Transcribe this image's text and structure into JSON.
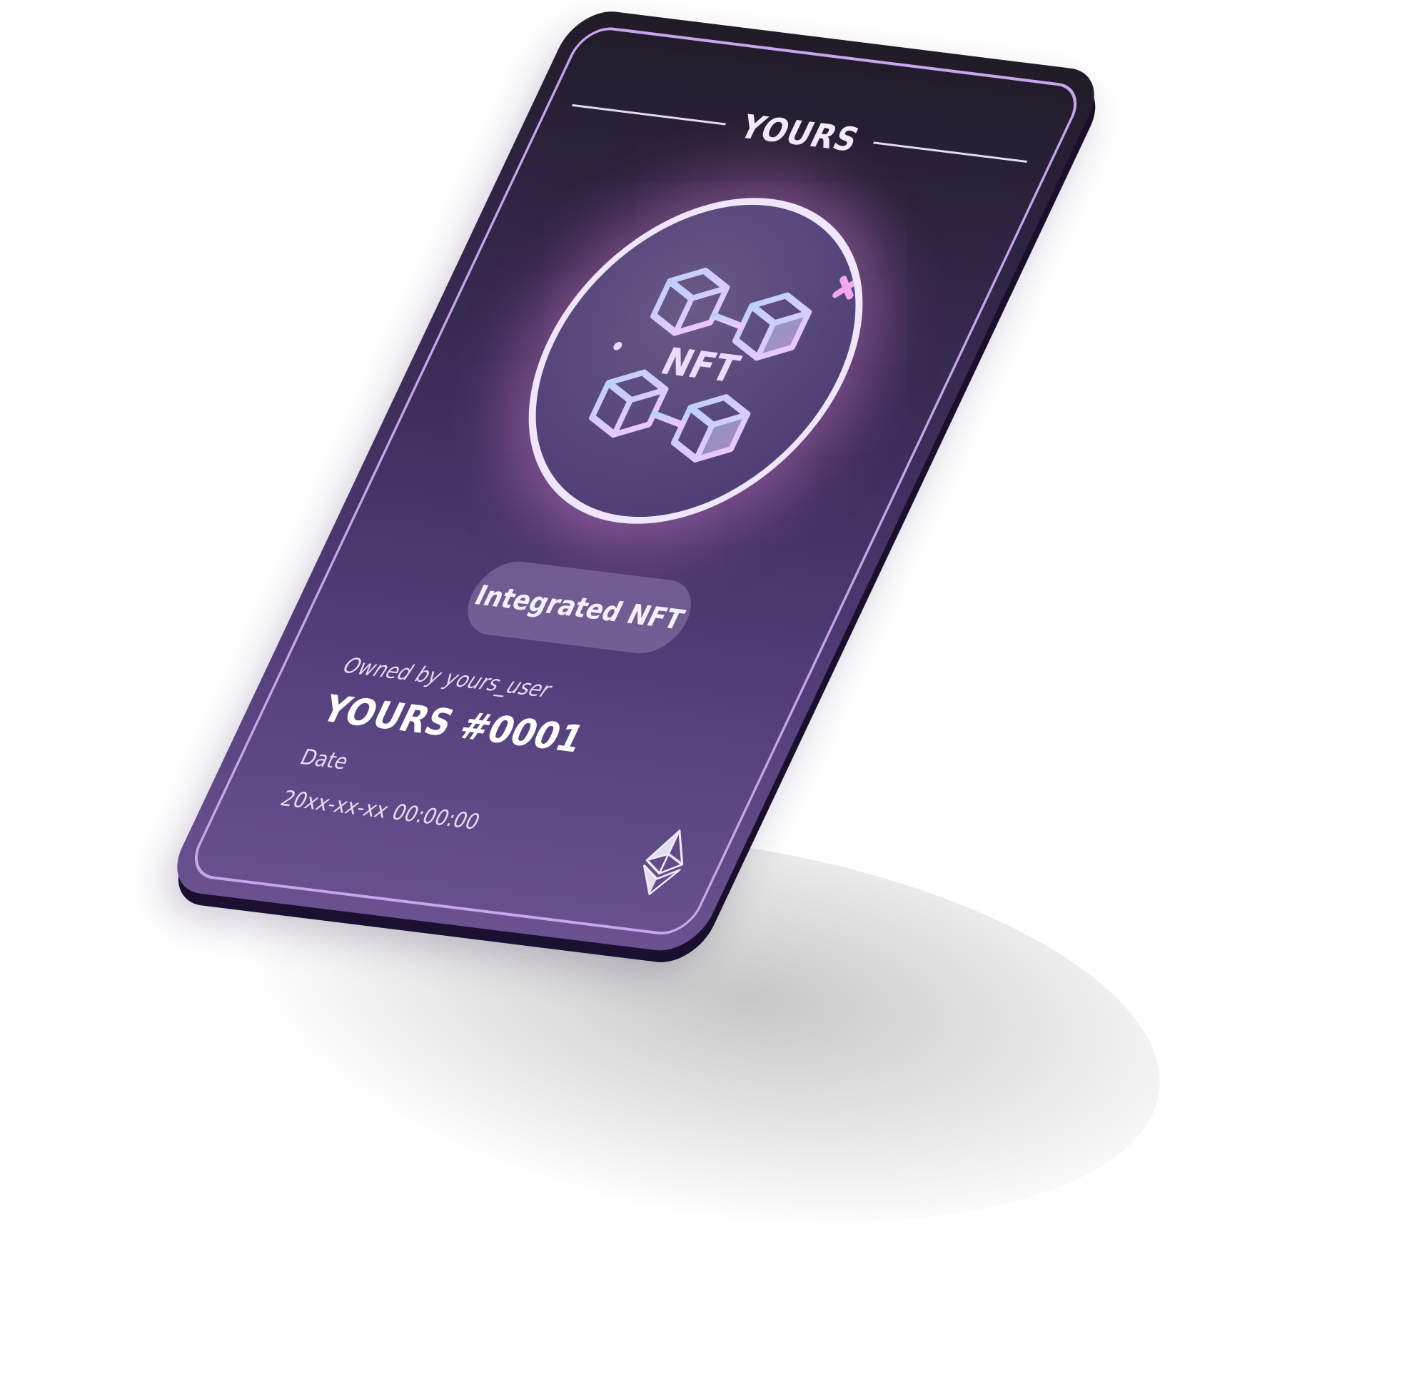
{
  "card": {
    "brand": "YOURS",
    "badge_label": "Integrated NFT",
    "owner_text": "Owned by yours_user",
    "token_name": "YOURS #0001",
    "date_label": "Date",
    "date_value": "20xx-xx-xx 00:00:00"
  },
  "emblem": {
    "icon_name": "nft-blocks-icon",
    "text": "NFT"
  },
  "chain_icon": "ethereum-icon",
  "colors": {
    "card_top": "#201b26",
    "card_bottom": "#6a5290",
    "border": "#c7a6ee",
    "glow": "#de82d6",
    "text": "#f2ecfa"
  }
}
